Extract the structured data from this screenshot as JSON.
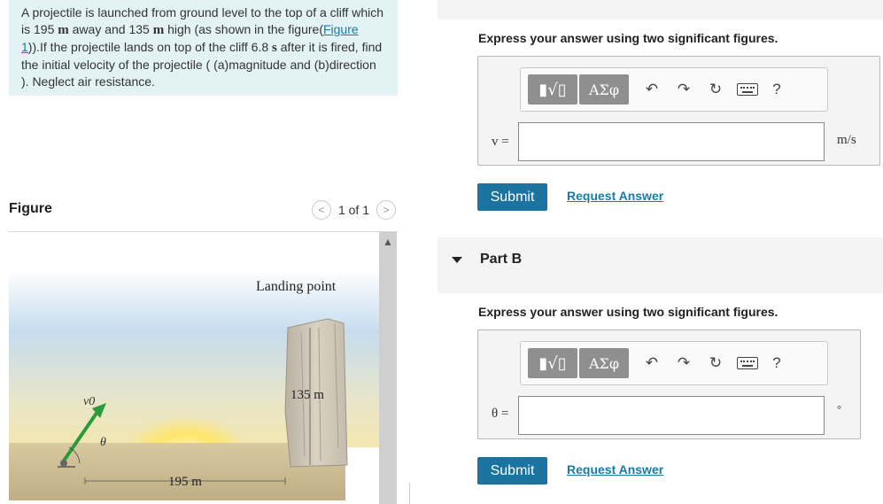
{
  "problem": {
    "text_1": "A projectile is launched from ground level to the top of a cliff which is 195 ",
    "unit_m1": "m",
    "text_2": " away and 135 ",
    "unit_m2": "m",
    "text_3": " high (as shown in the figure(",
    "figure_link": "Figure 1",
    "text_4": ")).If the projectile lands on top of the cliff 6.8 ",
    "unit_s": "s",
    "text_5": " after it is fired, find the initial velocity of the projectile ( (a)magnitude and (b)direction ). Neglect air resistance."
  },
  "figure_panel": {
    "title": "Figure",
    "pager_text": "1 of 1",
    "prev_glyph": "<",
    "next_glyph": ">",
    "labels": {
      "landing_point": "Landing point",
      "height": "135 m",
      "distance": "195 m",
      "velocity": "v0",
      "angle": "θ"
    }
  },
  "part_a": {
    "instruction": "Express your answer using two significant figures.",
    "variable": "v =",
    "unit": "m/s",
    "submit_label": "Submit",
    "request_label": "Request Answer"
  },
  "part_b": {
    "title": "Part B",
    "instruction": "Express your answer using two significant figures.",
    "variable": "θ =",
    "unit": "°",
    "submit_label": "Submit",
    "request_label": "Request Answer"
  },
  "toolbar": {
    "greek_label": "ΑΣφ",
    "help_label": "?",
    "icons": [
      "fraction-radical-icon",
      "undo-icon",
      "redo-icon",
      "reset-icon",
      "keyboard-icon",
      "help-icon"
    ]
  },
  "colors": {
    "accent": "#1b73a0",
    "link": "#1a7aa8",
    "problem_bg": "#e3f2f4"
  }
}
